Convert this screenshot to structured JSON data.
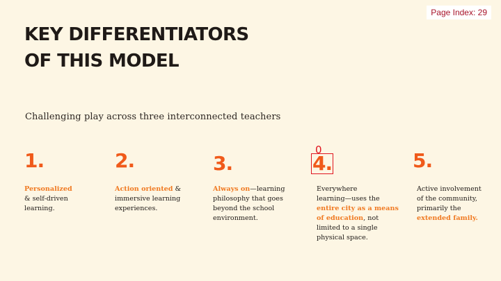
{
  "page_index": "Page Index: 29",
  "title": {
    "line1": "KEY DIFFERENTIATORS",
    "line2": "OF THIS MODEL"
  },
  "subtitle": "Challenging play across three interconnected teachers",
  "columns": [
    {
      "number": "1.",
      "parts": [
        {
          "text": "Personalized",
          "highlight": true
        },
        {
          "text": "\n& self-driven\nlearning.",
          "highlight": false
        }
      ]
    },
    {
      "number": "2.",
      "parts": [
        {
          "text": "Action oriented",
          "highlight": true
        },
        {
          "text": " &\nimmersive learning\nexperiences.",
          "highlight": false
        }
      ]
    },
    {
      "number": "3.",
      "parts": [
        {
          "text": "Always on",
          "highlight": true
        },
        {
          "text": "—learning\nphilosophy that goes\nbeyond the school\nenvironment.",
          "highlight": false
        }
      ]
    },
    {
      "number": "4.",
      "box_label": "0",
      "parts": [
        {
          "text": "Everywhere\nlearning—uses the\n",
          "highlight": false
        },
        {
          "text": "entire city as a means\nof education",
          "highlight": true
        },
        {
          "text": ", not\nlimited to a single\nphysical space.",
          "highlight": false
        }
      ]
    },
    {
      "number": "5.",
      "parts": [
        {
          "text": "Active involvement\nof the community,\nprimarily the\n",
          "highlight": false
        },
        {
          "text": "extended family.",
          "highlight": true
        }
      ]
    }
  ],
  "colors": {
    "background": "#fdf6e4",
    "accent": "#f05a1a",
    "highlight": "#f07a22",
    "annotation": "#e0141e"
  }
}
